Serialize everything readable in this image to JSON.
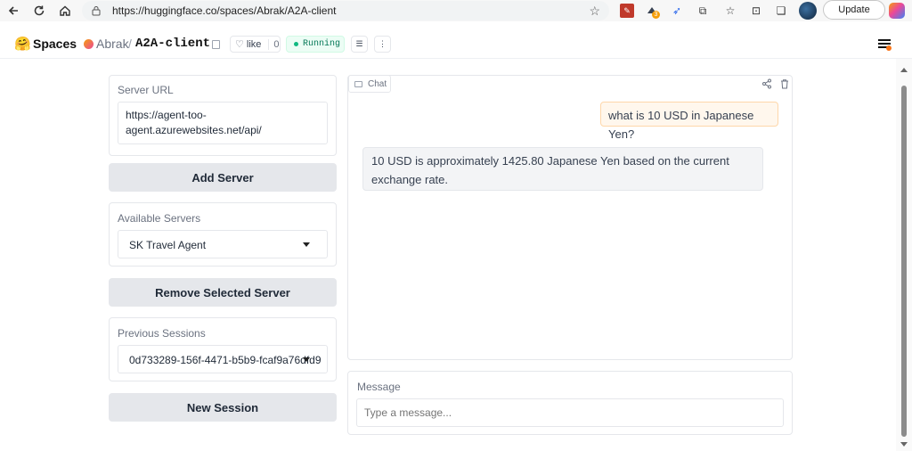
{
  "browser": {
    "url": "https://huggingface.co/spaces/Abrak/A2A-client",
    "update_label": "Update",
    "extension_badge": "3"
  },
  "header": {
    "brand": "Spaces",
    "owner": "Abrak",
    "separator": "/",
    "repo": "A2A-client",
    "like_label": "like",
    "like_count": "0",
    "status": "Running"
  },
  "left": {
    "server_url_label": "Server URL",
    "server_url_value": "https://agent-too-agent.azurewebsites.net/api/",
    "add_server_label": "Add Server",
    "available_servers_label": "Available Servers",
    "available_servers_selected": "SK Travel Agent",
    "remove_server_label": "Remove Selected Server",
    "previous_sessions_label": "Previous Sessions",
    "previous_sessions_selected": "0d733289-156f-4471-b5b9-fcaf9a76dfd9",
    "new_session_label": "New Session"
  },
  "chat": {
    "tab_label": "Chat",
    "messages": [
      {
        "role": "user",
        "text": "what is 10 USD in Japanese Yen?"
      },
      {
        "role": "assistant",
        "text": "10 USD is approximately 1425.80 Japanese Yen based on the current exchange rate."
      }
    ],
    "message_label": "Message",
    "message_placeholder": "Type a message..."
  }
}
